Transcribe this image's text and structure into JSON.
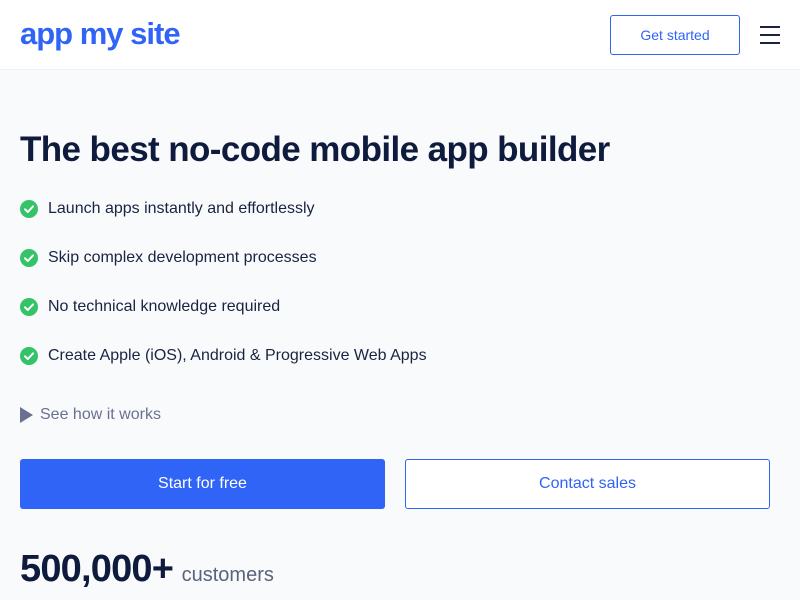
{
  "header": {
    "logo_text": "app my site",
    "get_started_label": "Get started",
    "menu_icon": "hamburger-menu-icon"
  },
  "hero": {
    "headline": "The best no-code mobile app builder",
    "features": [
      "Launch apps instantly and effortlessly",
      "Skip complex development processes",
      "No technical knowledge required",
      "Create Apple (iOS), Android & Progressive Web Apps"
    ],
    "feature_icon": "check-circle-icon",
    "see_how_label": "See how it works",
    "see_how_icon": "play-icon",
    "primary_cta_label": "Start for free",
    "secondary_cta_label": "Contact sales"
  },
  "stats": {
    "number": "500,000+",
    "label": "customers"
  },
  "colors": {
    "brand_blue": "#3064f6",
    "check_green": "#34c368",
    "heading_navy": "#0f1b3d",
    "muted_gray": "#6a7190"
  }
}
